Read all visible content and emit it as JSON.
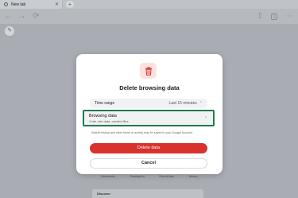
{
  "browser": {
    "tab_title": "New tab"
  },
  "page": {
    "shortcuts": [
      "Bookmarks",
      "Reading list",
      "Recent tabs",
      "History"
    ],
    "discover_label": "Discover"
  },
  "dialog": {
    "title": "Delete browsing data",
    "time_range_label": "Time range",
    "time_range_value": "Last 15 minutes",
    "browsing_data_label": "Browsing data",
    "browsing_data_summary": "1 tab, site data, cached files",
    "note": "Search history and other forms of activity may be saved in your Google Account.",
    "delete_label": "Delete data",
    "cancel_label": "Cancel"
  },
  "colors": {
    "accent_delete": "#d8322c",
    "highlight_border": "#1f7a52"
  },
  "icons": [
    "globe-icon",
    "close-icon",
    "plus-icon",
    "back-icon",
    "forward-icon",
    "reload-icon",
    "share-icon",
    "tab-count-icon",
    "more-icon",
    "edit-icon",
    "trash-icon",
    "chevron-right-icon"
  ]
}
